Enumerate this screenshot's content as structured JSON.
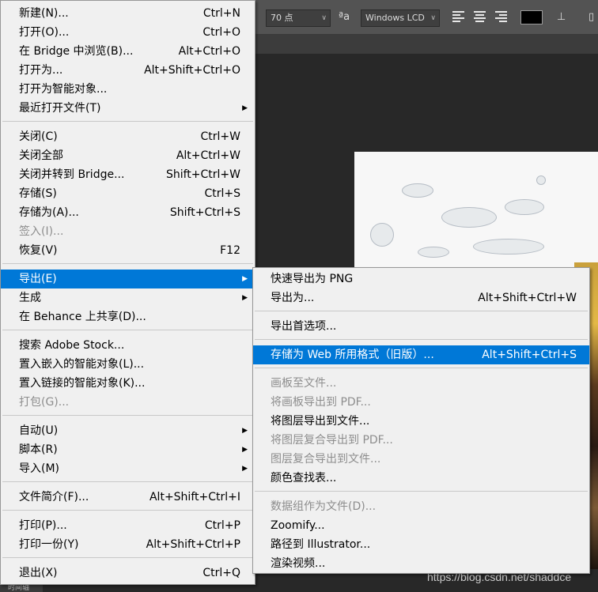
{
  "options_bar": {
    "font_size_value": "70 点",
    "aa_icon": "aa-icon",
    "antialias_value": "Windows LCD"
  },
  "timeline_tab": "时间轴",
  "watermark": "https://blog.csdn.net/shaddce",
  "main_menu": {
    "items": [
      {
        "label": "新建(N)...",
        "shortcut": "Ctrl+N"
      },
      {
        "label": "打开(O)...",
        "shortcut": "Ctrl+O"
      },
      {
        "label": "在 Bridge 中浏览(B)...",
        "shortcut": "Alt+Ctrl+O"
      },
      {
        "label": "打开为...",
        "shortcut": "Alt+Shift+Ctrl+O"
      },
      {
        "label": "打开为智能对象...",
        "shortcut": ""
      },
      {
        "label": "最近打开文件(T)",
        "shortcut": ""
      },
      {
        "label": "关闭(C)",
        "shortcut": "Ctrl+W"
      },
      {
        "label": "关闭全部",
        "shortcut": "Alt+Ctrl+W"
      },
      {
        "label": "关闭并转到 Bridge...",
        "shortcut": "Shift+Ctrl+W"
      },
      {
        "label": "存储(S)",
        "shortcut": "Ctrl+S"
      },
      {
        "label": "存储为(A)...",
        "shortcut": "Shift+Ctrl+S"
      },
      {
        "label": "签入(I)...",
        "shortcut": ""
      },
      {
        "label": "恢复(V)",
        "shortcut": "F12"
      },
      {
        "label": "导出(E)",
        "shortcut": ""
      },
      {
        "label": "生成",
        "shortcut": ""
      },
      {
        "label": "在 Behance 上共享(D)...",
        "shortcut": ""
      },
      {
        "label": "搜索 Adobe Stock...",
        "shortcut": ""
      },
      {
        "label": "置入嵌入的智能对象(L)...",
        "shortcut": ""
      },
      {
        "label": "置入链接的智能对象(K)...",
        "shortcut": ""
      },
      {
        "label": "打包(G)...",
        "shortcut": ""
      },
      {
        "label": "自动(U)",
        "shortcut": ""
      },
      {
        "label": "脚本(R)",
        "shortcut": ""
      },
      {
        "label": "导入(M)",
        "shortcut": ""
      },
      {
        "label": "文件简介(F)...",
        "shortcut": "Alt+Shift+Ctrl+I"
      },
      {
        "label": "打印(P)...",
        "shortcut": "Ctrl+P"
      },
      {
        "label": "打印一份(Y)",
        "shortcut": "Alt+Shift+Ctrl+P"
      },
      {
        "label": "退出(X)",
        "shortcut": "Ctrl+Q"
      }
    ]
  },
  "sub_menu": {
    "items": [
      {
        "label": "快速导出为 PNG",
        "shortcut": ""
      },
      {
        "label": "导出为...",
        "shortcut": "Alt+Shift+Ctrl+W"
      },
      {
        "label": "导出首选项...",
        "shortcut": ""
      },
      {
        "label": "存储为 Web 所用格式（旧版）...",
        "shortcut": "Alt+Shift+Ctrl+S"
      },
      {
        "label": "画板至文件...",
        "shortcut": ""
      },
      {
        "label": "将画板导出到 PDF...",
        "shortcut": ""
      },
      {
        "label": "将图层导出到文件...",
        "shortcut": ""
      },
      {
        "label": "将图层复合导出到 PDF...",
        "shortcut": ""
      },
      {
        "label": "图层复合导出到文件...",
        "shortcut": ""
      },
      {
        "label": "颜色查找表...",
        "shortcut": ""
      },
      {
        "label": "数据组作为文件(D)...",
        "shortcut": ""
      },
      {
        "label": "Zoomify...",
        "shortcut": ""
      },
      {
        "label": "路径到 Illustrator...",
        "shortcut": ""
      },
      {
        "label": "渲染视频...",
        "shortcut": ""
      }
    ]
  },
  "colors": {
    "highlight": "#0078d7",
    "menu_bg": "#f0f0f0",
    "disabled_text": "#8d8d8d"
  }
}
